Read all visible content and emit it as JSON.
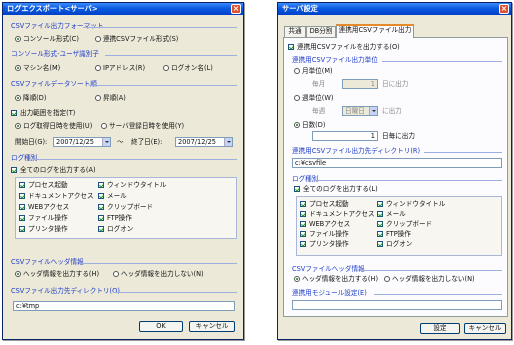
{
  "left": {
    "title": "ログエクスポート<サーバ>",
    "format_header": "CSVファイル出力フォーマット",
    "format_opt1": "コンソール形式(C)",
    "format_opt2": "連携CSVファイル形式(S)",
    "separator_header": "コンソール形式-ユーザ識別子",
    "sep_opt1": "マシン名(M)",
    "sep_opt2": "IPアドレス(R)",
    "sep_opt3": "ログオン名(L)",
    "order_header": "CSVファイルデータソート順",
    "order_opt1": "降順(D)",
    "order_opt2": "昇順(A)",
    "range_check": "出力範囲を指定(T)",
    "range_opt1": "ログ取得日時を使用(U)",
    "range_opt2": "サーバ登録日時を使用(Y)",
    "start_label": "開始日(G):",
    "start_value": "2007/12/25",
    "tilde": "～",
    "end_label": "終了日(E):",
    "end_value": "2007/12/25",
    "logtype_header": "ログ種別",
    "all_logs": "全てのログを出力する(A)",
    "logs_col1": [
      "プロセス起動",
      "ドキュメントアクセス",
      "WEBアクセス",
      "ファイル操作",
      "プリンタ操作"
    ],
    "logs_col2": [
      "ウィンドウタイトル",
      "メール",
      "クリップボード",
      "FTP操作",
      "ログオン"
    ],
    "csvheader_header": "CSVファイルヘッダ情報",
    "header_opt1": "ヘッダ情報を出力する(H)",
    "header_opt2": "ヘッダ情報を出力しない(N)",
    "dir_header": "CSVファイル出力先ディレクトリ(O)",
    "dir_value": "c:¥tmp",
    "ok": "OK",
    "cancel": "キャンセル"
  },
  "right": {
    "title": "サーバ設定",
    "tabs": [
      "共通",
      "DB分割",
      "連携用CSVファイル出力"
    ],
    "output_check": "連携用CSVファイルを出力する(O)",
    "unit_header": "連携用CSVファイル出力単位",
    "monthly": "月単位(M)",
    "every_month": "毎月",
    "month_day": "1",
    "month_suffix": "日に出力",
    "weekly": "週単位(W)",
    "every_week": "毎週",
    "weekday": "日曜日",
    "week_suffix": "に出力",
    "daily": "日数(D)",
    "days_value": "1",
    "days_suffix": "日毎に出力",
    "dir_header": "連携用CSVファイル出力先ディレクトリ(R)",
    "dir_value": "c:¥csvfile",
    "logtype_header": "ログ種別",
    "all_logs": "全てのログを出力する(L)",
    "logs_col1": [
      "プロセス起動",
      "ドキュメントアクセス",
      "WEBアクセス",
      "ファイル操作",
      "プリンタ操作"
    ],
    "logs_col2": [
      "ウィンドウタイトル",
      "メール",
      "クリップボード",
      "FTP操作",
      "ログオン"
    ],
    "csvheader_header": "CSVファイルヘッダ情報",
    "header_opt1": "ヘッダ情報を出力する(H)",
    "header_opt2": "ヘッダ情報を出力しない(N)",
    "module_header": "連携用モジュール設定(E)",
    "module_value": "",
    "apply": "設定",
    "cancel": "キャンセル"
  }
}
